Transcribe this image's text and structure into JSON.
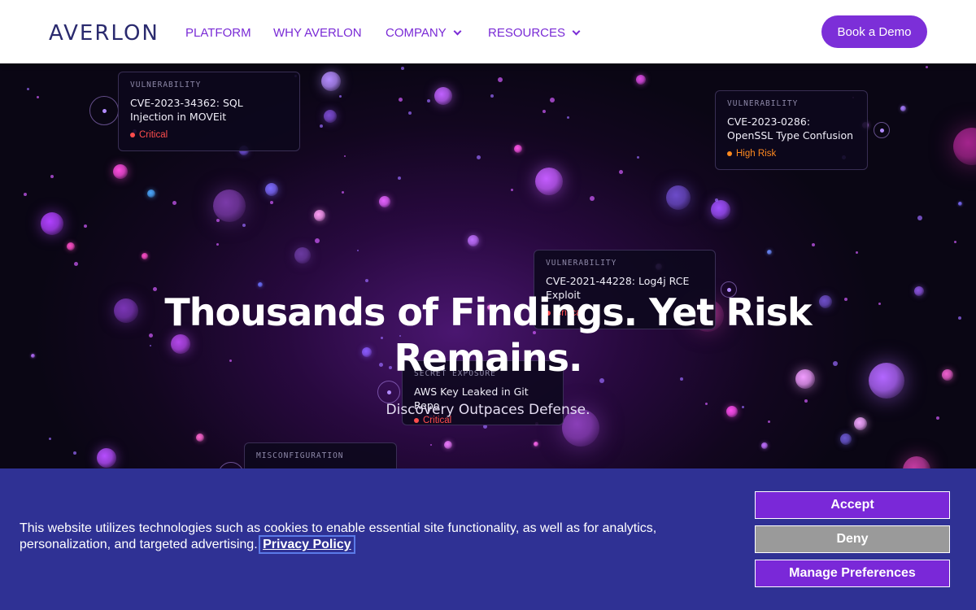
{
  "nav": {
    "logo": "AVERLON",
    "links": [
      {
        "label": "PLATFORM"
      },
      {
        "label": "WHY AVERLON"
      },
      {
        "label": "COMPANY",
        "icon": "chevron-down-icon"
      },
      {
        "label": "RESOURCES",
        "icon": "chevron-down-icon"
      }
    ],
    "cta": "Book a Demo"
  },
  "hero": {
    "headline": "Thousands of Findings. Yet Risk Remains.",
    "subheadline": "Discovery Outpaces Defense.",
    "cards": [
      {
        "category": "VULNERABILITY",
        "title": "CVE-2023-34362: SQL Injection in MOVEit",
        "severity": "Critical",
        "severity_color": "#ff4d4d"
      },
      {
        "category": "VULNERABILITY",
        "title": "CVE-2023-0286: OpenSSL Type Confusion",
        "severity": "High Risk",
        "severity_color": "#ff8a1f"
      },
      {
        "category": "VULNERABILITY",
        "title": "CVE-2021-44228: Log4j RCE Exploit",
        "severity": "Critical",
        "severity_color": "#ff4d4d"
      },
      {
        "category": "SECRET EXPOSURE",
        "title": "AWS Key Leaked in Git Repo",
        "severity": "Critical",
        "severity_color": "#ff4d4d"
      },
      {
        "category": "MISCONFIGURATION",
        "title": "",
        "severity": "",
        "severity_color": "#ff4d4d"
      }
    ]
  },
  "cookie_banner": {
    "text": "This website utilizes technologies such as cookies to enable essential site functionality, as well as for analytics, personalization, and targeted advertising.",
    "privacy_link": "Privacy Policy",
    "accept": "Accept",
    "deny": "Deny",
    "manage": "Manage Preferences"
  },
  "colors": {
    "brand_purple": "#7c2fd8",
    "cookie_bg": "#2f3194",
    "deny_gray": "#9a9a9a",
    "logo_navy": "#2a2a6e"
  }
}
